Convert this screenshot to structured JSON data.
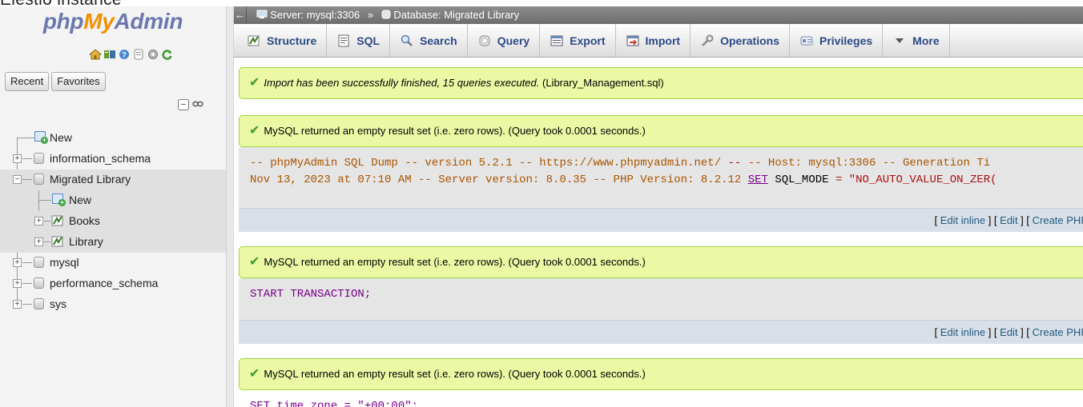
{
  "caption": "Elestio instance",
  "sidebar": {
    "logo": {
      "php": "php",
      "my": "My",
      "admin": "Admin"
    },
    "quick_icons": [
      "home-icon",
      "database-icon",
      "help-icon",
      "docs-icon",
      "settings-icon",
      "reload-icon"
    ],
    "tabs": [
      "Recent",
      "Favorites"
    ],
    "tree": [
      {
        "label": "New",
        "icon": "new-icon"
      },
      {
        "label": "information_schema",
        "icon": "database-icon"
      },
      {
        "label": "Migrated Library",
        "icon": "database-icon",
        "selected": true
      },
      {
        "label": "New",
        "icon": "new-icon"
      },
      {
        "label": "Books",
        "icon": "table-icon"
      },
      {
        "label": "Library",
        "icon": "table-icon"
      },
      {
        "label": "mysql",
        "icon": "database-icon"
      },
      {
        "label": "performance_schema",
        "icon": "database-icon"
      },
      {
        "label": "sys",
        "icon": "database-icon"
      }
    ]
  },
  "breadcrumb": {
    "server": "Server: mysql:3306",
    "separator": "»",
    "database": "Database: Migrated Library"
  },
  "menu": [
    {
      "label": "Structure",
      "icon": "structure-icon"
    },
    {
      "label": "SQL",
      "icon": "sql-icon"
    },
    {
      "label": "Search",
      "icon": "search-icon"
    },
    {
      "label": "Query",
      "icon": "query-icon"
    },
    {
      "label": "Export",
      "icon": "export-icon"
    },
    {
      "label": "Import",
      "icon": "import-icon"
    },
    {
      "label": "Operations",
      "icon": "wrench-icon"
    },
    {
      "label": "Privileges",
      "icon": "privileges-icon"
    },
    {
      "label": "More",
      "icon": "triangle-down-icon"
    }
  ],
  "import_msg": {
    "italic": "Import has been successfully finished, 15 queries executed.",
    "file": " (Library_Management.sql)"
  },
  "results": [
    {
      "message": "MySQL returned an empty result set (i.e. zero rows). (Query took 0.0001 seconds.)",
      "sql_line1": {
        "comment": "-- phpMyAdmin SQL Dump -- version 5.2.1 -- https://www.phpmyadmin.net/ ",
        "dash": "--",
        "rest": " -- Host: mysql:3306 -- Generation Ti"
      },
      "sql_line2": {
        "comment": "Nov 13, 2023 at 07:10 AM -- Server version: 8.0.35 -- PHP Version: 8.2.12 ",
        "kw": "SET",
        "var": " SQL_MODE ",
        "op": "=",
        "str": " \"NO_AUTO_VALUE_ON_ZER("
      },
      "actions": {
        "edit_inline": "Edit inline",
        "edit": "Edit",
        "create_php": "Create PHP"
      }
    },
    {
      "message": "MySQL returned an empty result set (i.e. zero rows). (Query took 0.0001 seconds.)",
      "sql": "START TRANSACTION;",
      "actions": {
        "edit_inline": "Edit inline",
        "edit": "Edit",
        "create_php": "Create PHP"
      }
    },
    {
      "message": "MySQL returned an empty result set (i.e. zero rows). (Query took 0.0001 seconds.)",
      "sql_partial": "SET time_zone = \"+00:00\";"
    }
  ]
}
